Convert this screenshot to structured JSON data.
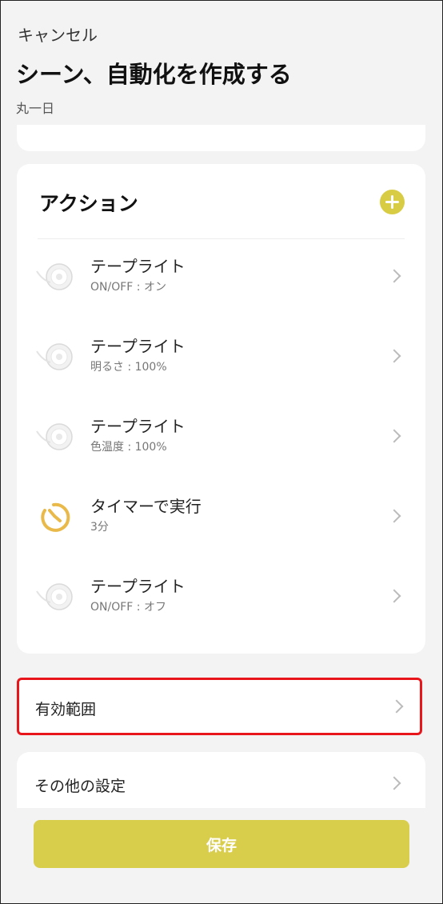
{
  "header": {
    "cancel_label": "キャンセル",
    "title": "シーン、自動化を作成する",
    "subtitle": "丸一日"
  },
  "actions": {
    "title": "アクション",
    "add_icon": "plus-circle-icon",
    "items": [
      {
        "name": "テープライト",
        "detail": "ON/OFF : オン",
        "icon": "tape-light-icon"
      },
      {
        "name": "テープライト",
        "detail": "明るさ : 100%",
        "icon": "tape-light-icon"
      },
      {
        "name": "テープライト",
        "detail": "色温度 : 100%",
        "icon": "tape-light-icon"
      },
      {
        "name": "タイマーで実行",
        "detail": "3分",
        "icon": "timer-icon"
      },
      {
        "name": "テープライト",
        "detail": "ON/OFF : オフ",
        "icon": "tape-light-icon"
      }
    ]
  },
  "scope": {
    "label": "有効範囲"
  },
  "other_settings": {
    "label": "その他の設定"
  },
  "save": {
    "label": "保存"
  },
  "colors": {
    "accent": "#d9cd4c",
    "highlight_border": "#e8151b",
    "timer_icon": "#e9b94a",
    "background": "#f3f3f3"
  }
}
